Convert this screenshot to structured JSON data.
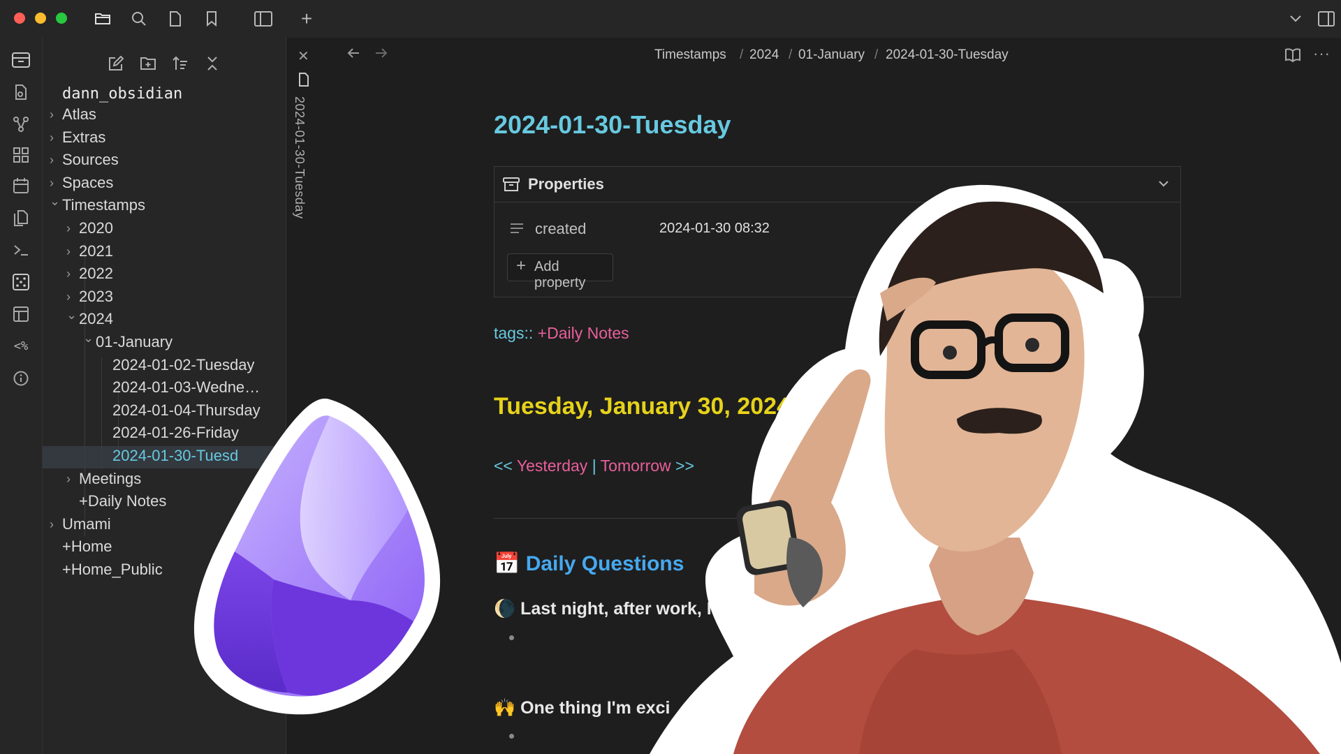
{
  "window": {
    "traffic_colors": [
      "#ff5f57",
      "#febc2e",
      "#28c840"
    ]
  },
  "titlebar": {
    "icons": [
      "folder-icon",
      "search-icon",
      "file-icon",
      "bookmark-icon",
      "sidebar-toggle-icon",
      "new-tab-icon"
    ],
    "right_icons": [
      "chevron-down-icon",
      "right-sidebar-toggle-icon"
    ]
  },
  "ribbon": {
    "icons": [
      "archive-icon",
      "files-icon",
      "graph-icon",
      "grid-icon",
      "calendar-icon",
      "copy-icon",
      "terminal-icon",
      "dice-icon",
      "layout-icon",
      "template-icon",
      "info-icon"
    ],
    "template_glyph": "<%"
  },
  "sidebar": {
    "tool_icons": [
      "new-note-icon",
      "new-folder-icon",
      "sort-icon",
      "collapse-all-icon"
    ],
    "vault_name": "dann_obsidian",
    "tree": [
      {
        "label": "Atlas",
        "level": 0,
        "chevron": "right"
      },
      {
        "label": "Extras",
        "level": 0,
        "chevron": "right"
      },
      {
        "label": "Sources",
        "level": 0,
        "chevron": "right"
      },
      {
        "label": "Spaces",
        "level": 0,
        "chevron": "right"
      },
      {
        "label": "Timestamps",
        "level": 0,
        "chevron": "down"
      },
      {
        "label": "2020",
        "level": 1,
        "chevron": "right"
      },
      {
        "label": "2021",
        "level": 1,
        "chevron": "right"
      },
      {
        "label": "2022",
        "level": 1,
        "chevron": "right"
      },
      {
        "label": "2023",
        "level": 1,
        "chevron": "right"
      },
      {
        "label": "2024",
        "level": 1,
        "chevron": "down"
      },
      {
        "label": "01-January",
        "level": 2,
        "chevron": "down"
      },
      {
        "label": "2024-01-02-Tuesday",
        "level": 3,
        "chevron": ""
      },
      {
        "label": "2024-01-03-Wedne…",
        "level": 3,
        "chevron": ""
      },
      {
        "label": "2024-01-04-Thursday",
        "level": 3,
        "chevron": ""
      },
      {
        "label": "2024-01-26-Friday",
        "level": 3,
        "chevron": ""
      },
      {
        "label": "2024-01-30-Tuesd",
        "level": 3,
        "chevron": "",
        "active": true
      },
      {
        "label": "Meetings",
        "level": 1,
        "chevron": "right"
      },
      {
        "label": "+Daily Notes",
        "level": 1,
        "chevron": ""
      },
      {
        "label": "Umami",
        "level": 0,
        "chevron": "right"
      },
      {
        "label": "+Home",
        "level": 0,
        "chevron": ""
      },
      {
        "label": "+Home_Public",
        "level": 0,
        "chevron": ""
      }
    ]
  },
  "tabstrip": {
    "vertical_tab_label": "2024-01-30-Tuesday"
  },
  "editor": {
    "breadcrumbs": [
      "Timestamps",
      "2024",
      "01-January",
      "2024-01-30-Tuesday"
    ],
    "separator": "/",
    "note_title": "2024-01-30-Tuesday",
    "properties": {
      "header": "Properties",
      "rows": [
        {
          "key": "created",
          "value": "2024-01-30 08:32"
        }
      ],
      "add_label": "Add property"
    },
    "tags_prefix": "tags::",
    "tags_value": "+Daily Notes",
    "day_heading": "Tuesday, January 30, 2024",
    "nav": {
      "prev_arrows": "<<",
      "yesterday": "Yesterday",
      "divider": "|",
      "tomorrow": "Tomorrow",
      "next_arrows": ">>"
    },
    "section_emoji": "📅",
    "section_title": "Daily Questions",
    "questions": [
      {
        "emoji": "🌘",
        "text": "Last night, after work, I"
      },
      {
        "emoji": "🙌",
        "text": "One thing I'm exci"
      }
    ]
  },
  "colors": {
    "title": "#67c9e0",
    "tags_prefix": "#67c9e0",
    "link": "#e95f9c",
    "day_heading": "#e6d21a",
    "section": "#46a9f0"
  }
}
